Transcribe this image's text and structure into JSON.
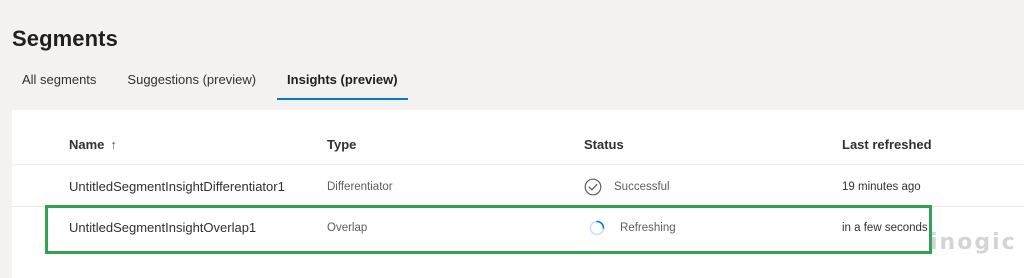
{
  "page": {
    "title": "Segments"
  },
  "tabs": [
    {
      "label": "All segments",
      "active": false
    },
    {
      "label": "Suggestions (preview)",
      "active": false
    },
    {
      "label": "Insights (preview)",
      "active": true
    }
  ],
  "table": {
    "columns": {
      "name": "Name",
      "name_sort": "↑",
      "type": "Type",
      "status": "Status",
      "last_refreshed": "Last refreshed"
    },
    "rows": [
      {
        "name": "UntitledSegmentInsightDifferentiator1",
        "type": "Differentiator",
        "status": "Successful",
        "status_icon": "check-circle-icon",
        "last_refreshed": "19 minutes ago"
      },
      {
        "name": "UntitledSegmentInsightOverlap1",
        "type": "Overlap",
        "status": "Refreshing",
        "status_icon": "spinner-icon",
        "last_refreshed": "in a few seconds"
      }
    ]
  },
  "annotation": {
    "color": "#2ea44f"
  },
  "watermark": {
    "text": "inogic"
  },
  "colors": {
    "accent": "#0078d4",
    "background": "#f3f2f1",
    "panel": "#ffffff"
  }
}
